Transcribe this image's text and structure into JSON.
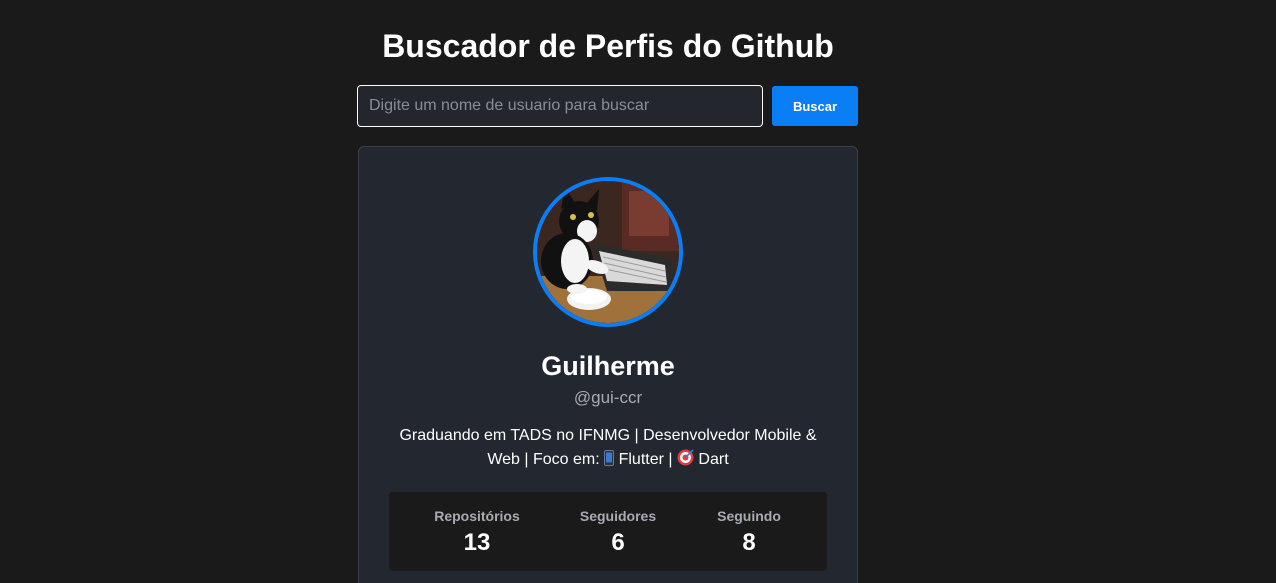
{
  "header": {
    "title": "Buscador de Perfis do Github"
  },
  "search": {
    "placeholder": "Digite um nome de usuario para buscar",
    "value": "",
    "button_label": "Buscar"
  },
  "profile": {
    "name": "Guilherme",
    "login": "@gui-ccr",
    "bio_part1": "Graduando em TADS no IFNMG | Desenvolvedor Mobile & Web | Foco em: ",
    "bio_part2": " Flutter | ",
    "bio_part3": " Dart",
    "bio_icons": [
      "mobile-phone-icon",
      "target-icon"
    ]
  },
  "stats": [
    {
      "label": "Repositórios",
      "value": "13"
    },
    {
      "label": "Seguidores",
      "value": "6"
    },
    {
      "label": "Seguindo",
      "value": "8"
    }
  ],
  "colors": {
    "background": "#1a1a1b",
    "card": "#23272f",
    "accent": "#0a7ef5",
    "muted_text": "#a8abb1"
  }
}
